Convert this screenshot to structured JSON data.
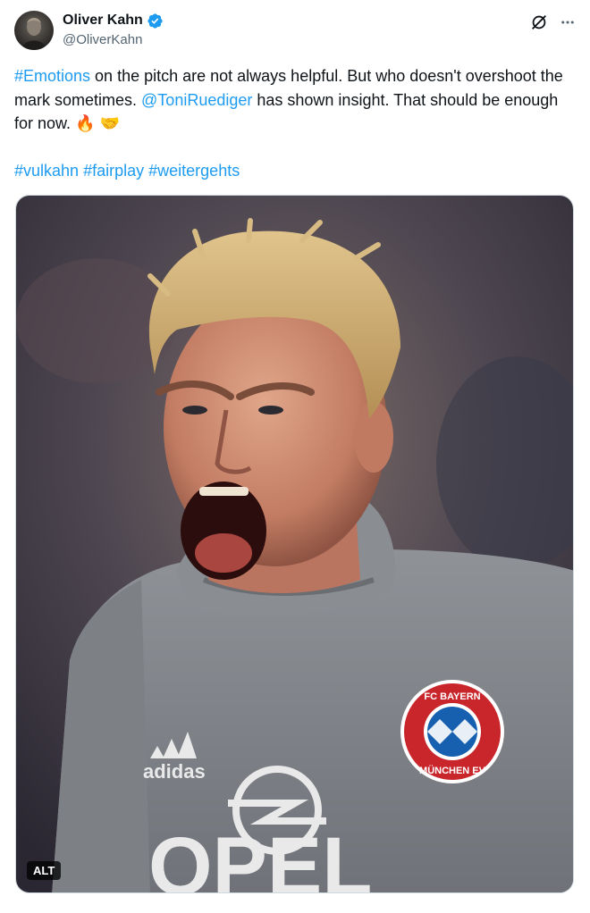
{
  "author": {
    "display_name": "Oliver Kahn",
    "handle": "@OliverKahn",
    "verified": true
  },
  "icons": {
    "verified": "verified-badge-icon",
    "grok": "grok-icon",
    "more": "more-icon",
    "fire": "fire-emoji",
    "handshake": "handshake-emoji"
  },
  "colors": {
    "link": "#1d9bf0",
    "text": "#0f1419",
    "secondary": "#536471"
  },
  "tweet": {
    "hashtag_emotions": "#Emotions",
    "text_part1": " on the pitch are not always helpful. But who doesn't overshoot the mark sometimes. ",
    "mention": "@ToniRuediger",
    "text_part2": " has shown insight. That should be enough for now. ",
    "emoji_fire": "🔥",
    "emoji_handshake": "🤝",
    "hashtags": [
      "#vulkahn",
      "#fairplay",
      "#weitergehts"
    ]
  },
  "media": {
    "alt_badge": "ALT",
    "jersey_brand": "adidas",
    "jersey_sponsor": "OPEL",
    "club_crest_top": "FC BAYERN",
    "club_crest_bottom": "MÜNCHEN EV"
  }
}
